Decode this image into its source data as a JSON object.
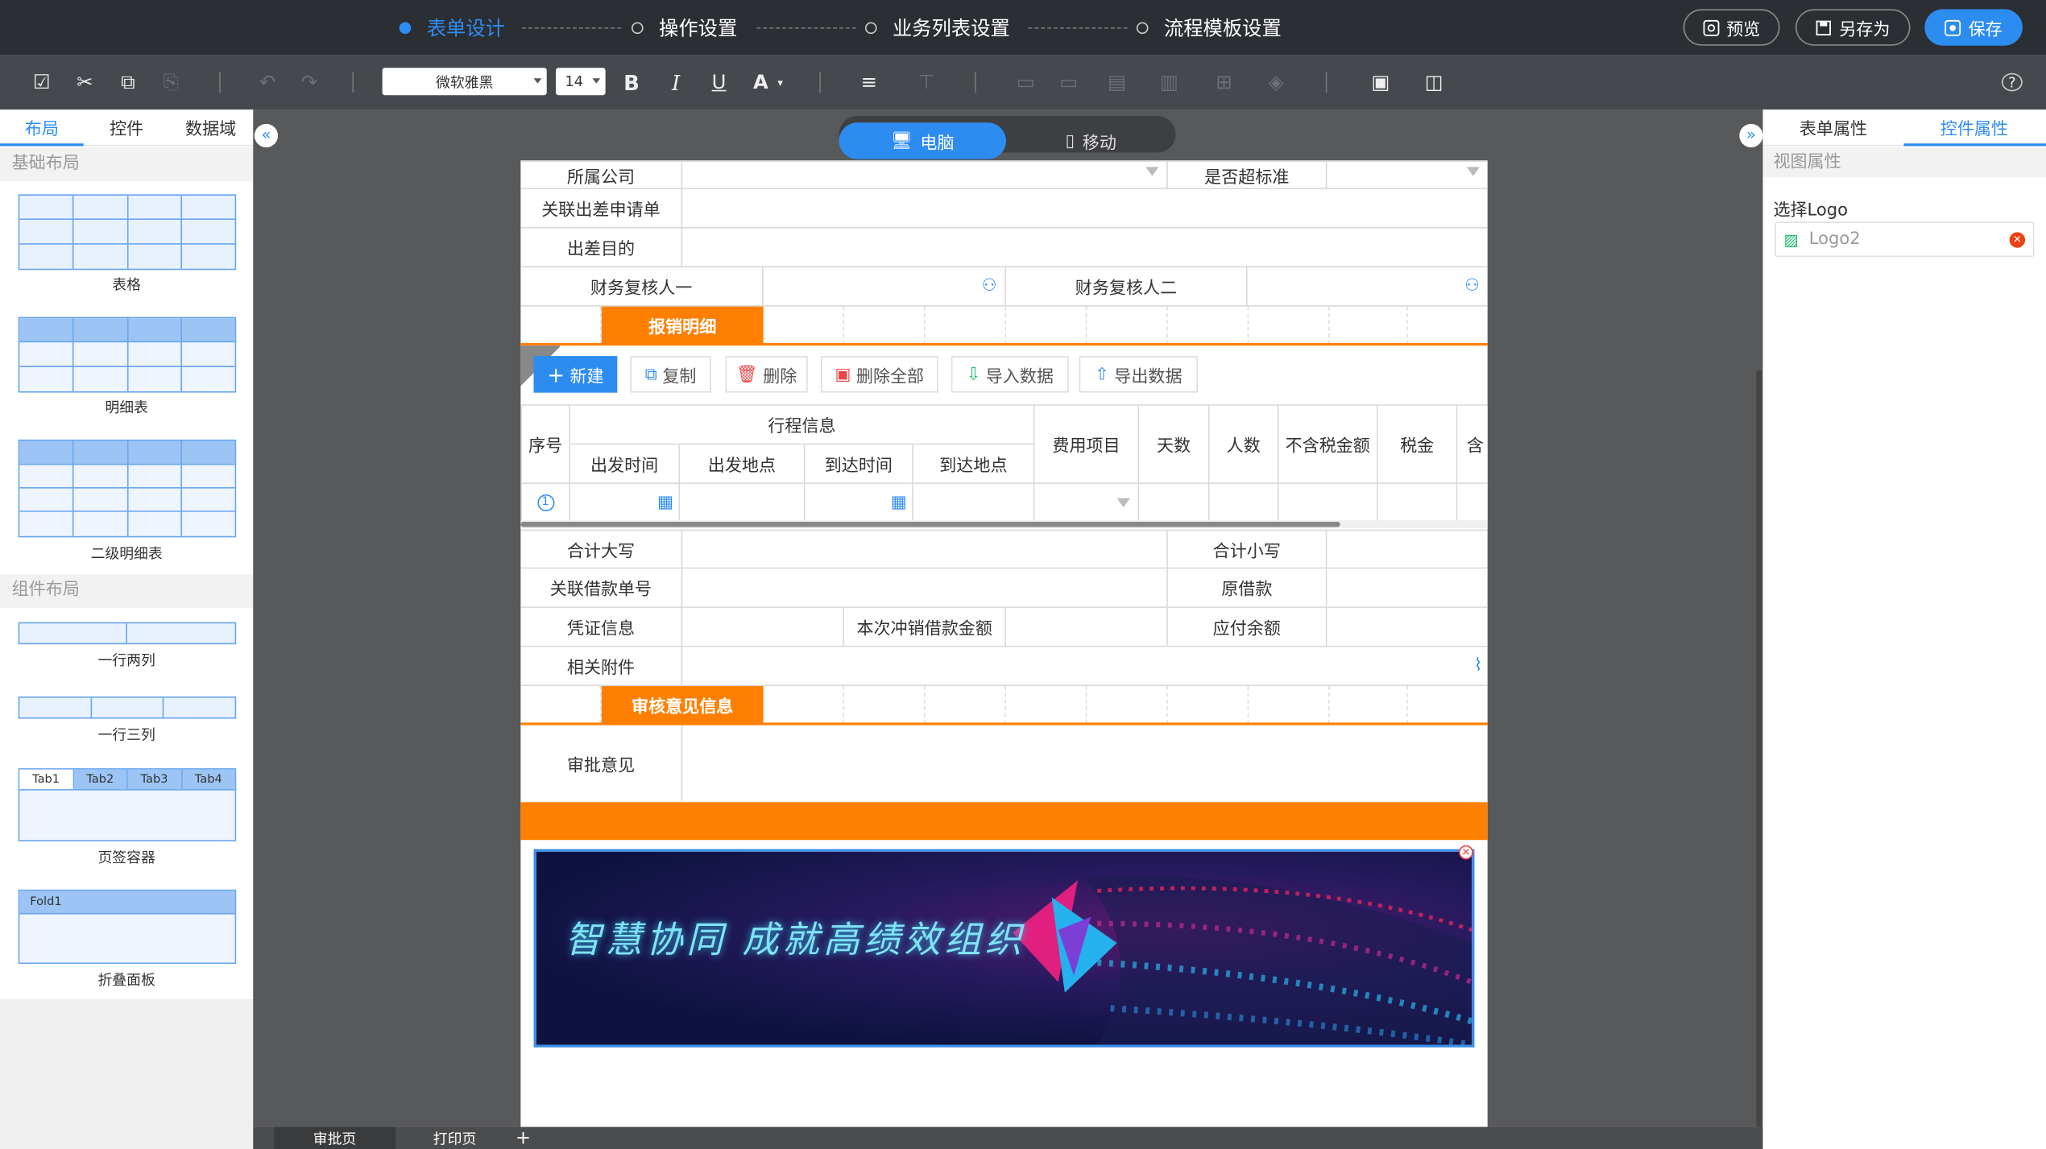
{
  "steps": [
    {
      "label": "表单设计",
      "active": true
    },
    {
      "label": "操作设置",
      "active": false
    },
    {
      "label": "业务列表设置",
      "active": false
    },
    {
      "label": "流程模板设置",
      "active": false
    }
  ],
  "top_buttons": {
    "preview": "预览",
    "save_as": "另存为",
    "save": "保存"
  },
  "toolbar": {
    "font_family": "微软雅黑",
    "font_size": "14",
    "bold": "B",
    "italic": "I",
    "underline": "U",
    "font_color": "A",
    "help": "?"
  },
  "left_panel": {
    "tabs": [
      "布局",
      "控件",
      "数据域"
    ],
    "basic_layout_header": "基础布局",
    "basic_items": [
      "表格",
      "明细表",
      "二级明细表"
    ],
    "component_layout_header": "组件布局",
    "component_items": [
      "一行两列",
      "一行三列",
      "页签容器",
      "折叠面板"
    ],
    "tab_labels": [
      "Tab1",
      "Tab2",
      "Tab3",
      "Tab4"
    ],
    "fold_label": "Fold1"
  },
  "device_toggle": {
    "desktop": "电脑",
    "mobile": "移动"
  },
  "form": {
    "company": "所属公司",
    "over_standard": "是否超标准",
    "related_trip": "关联出差申请单",
    "trip_purpose": "出差目的",
    "reviewer1": "财务复核人一",
    "reviewer2": "财务复核人二",
    "detail_section": "报销明细",
    "detail_buttons": [
      "新建",
      "复制",
      "删除",
      "删除全部",
      "导入数据",
      "导出数据"
    ],
    "table_headers": {
      "seq": "序号",
      "trip_info": "行程信息",
      "depart_time": "出发时间",
      "depart_place": "出发地点",
      "arrive_time": "到达时间",
      "arrive_place": "到达地点",
      "expense_item": "费用项目",
      "days": "天数",
      "people": "人数",
      "amount_ex_tax": "不含税金额",
      "tax": "税金",
      "incl": "含"
    },
    "row_seq": "1",
    "total_upper": "合计大写",
    "total_lower": "合计小写",
    "loan_no": "关联借款单号",
    "original_loan": "原借款",
    "voucher": "凭证信息",
    "offset_amount": "本次冲销借款金额",
    "payable": "应付余额",
    "attachment": "相关附件",
    "review_section": "审核意见信息",
    "review_opinion": "审批意见",
    "banner_text": "智慧协同 成就高绩效组织"
  },
  "bottom_tabs": [
    "审批页",
    "打印页",
    "+"
  ],
  "right_panel": {
    "tabs": [
      "表单属性",
      "控件属性"
    ],
    "view_props": "视图属性",
    "select_logo": "选择Logo",
    "logo_value": "Logo2"
  },
  "colors": {
    "accent": "#2d8cf0",
    "orange": "#ff7f00",
    "topbar": "#2b2e33",
    "toolbar": "#45484d"
  }
}
